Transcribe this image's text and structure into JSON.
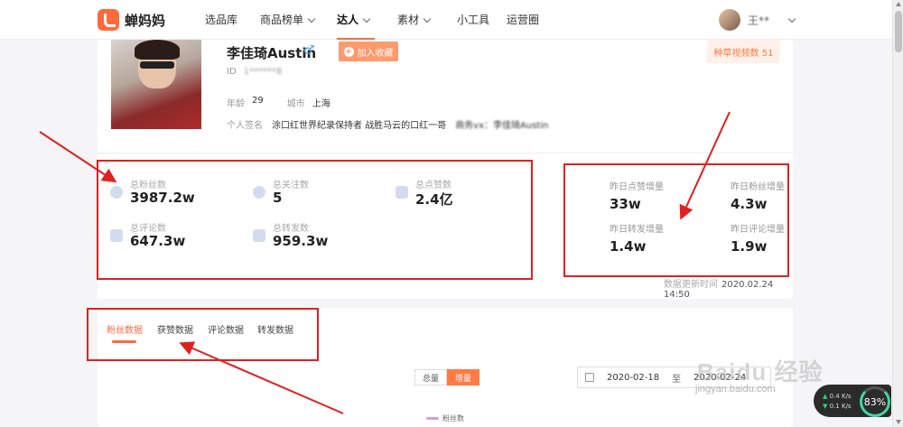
{
  "nav": {
    "brand": "蝉妈妈",
    "items": [
      {
        "label": "选品库",
        "has_dropdown": false
      },
      {
        "label": "商品榜单",
        "has_dropdown": true
      },
      {
        "label": "达人",
        "has_dropdown": true,
        "active": true
      },
      {
        "label": "素材",
        "has_dropdown": true
      },
      {
        "label": "小工具",
        "has_dropdown": false
      },
      {
        "label": "运营圈",
        "has_dropdown": false
      }
    ],
    "user_name": "王**"
  },
  "profile": {
    "name": "李佳琦Austin",
    "gender_icon": "♂",
    "favorite_button": "加入收藏",
    "video_badge": "种草视频数 51",
    "id_label": "ID",
    "id_value": "1******8",
    "age_label": "年龄",
    "age_value": "29",
    "city_label": "城市",
    "city_value": "上海",
    "signature_label": "个人签名",
    "signature_value": "涂口红世界纪录保持者 战胜马云的口红一哥",
    "signature_blurred": "商务vx：李佳琦Austin"
  },
  "stats": {
    "total_fans_label": "总粉丝数",
    "total_fans": "3987.2w",
    "total_follow_label": "总关注数",
    "total_follow": "5",
    "total_likes_label": "总点赞数",
    "total_likes": "2.4亿",
    "total_comments_label": "总评论数",
    "total_comments": "647.3w",
    "total_shares_label": "总转发数",
    "total_shares": "959.3w"
  },
  "daily": {
    "likes_label": "昨日点赞增量",
    "likes": "33w",
    "fans_label": "昨日粉丝增量",
    "fans": "4.3w",
    "shares_label": "昨日转发增量",
    "shares": "1.4w",
    "comments_label": "昨日评论增量",
    "comments": "1.9w"
  },
  "update": {
    "label": "数据更新时间",
    "value": "2020.02.24 14:50"
  },
  "tabs": [
    "粉丝数据",
    "获赞数据",
    "评论数据",
    "转发数据"
  ],
  "toggle": {
    "total": "总量",
    "increment": "增量"
  },
  "date": {
    "start": "2020-02-18",
    "separator": "至",
    "end": "2020-02-24"
  },
  "legend": {
    "series": "粉丝数"
  },
  "watermark": {
    "main": "Baidu 经验",
    "sub": "jingyan.baidu.com"
  },
  "network": {
    "speed_up": "0.4 K/s",
    "speed_down": "0.1 K/s",
    "percent": "83%"
  },
  "colors": {
    "accent": "#ff6a3d",
    "annotation": "#e02020"
  }
}
